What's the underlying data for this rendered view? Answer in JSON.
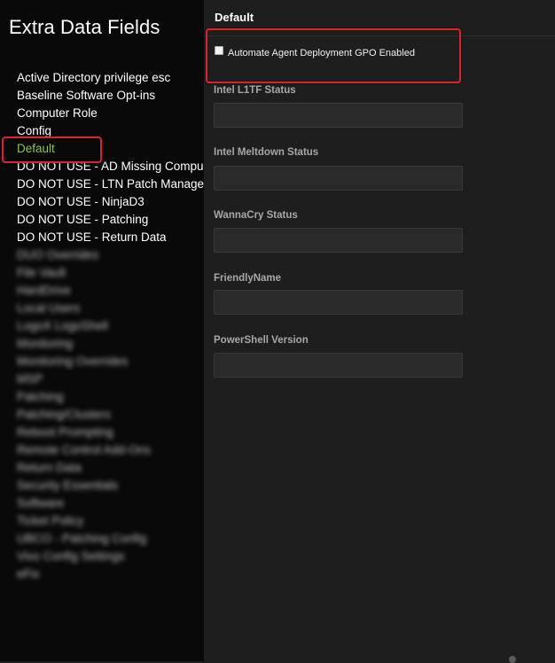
{
  "sidebar": {
    "title": "Extra Data Fields",
    "items": [
      {
        "label": "Active Directory privilege esc",
        "blurred": false
      },
      {
        "label": "Baseline Software Opt-ins",
        "blurred": false
      },
      {
        "label": "Computer Role",
        "blurred": false
      },
      {
        "label": "Config",
        "blurred": false
      },
      {
        "label": "Default",
        "blurred": false,
        "active": true
      },
      {
        "label": "DO NOT USE - AD Missing Compu",
        "blurred": false
      },
      {
        "label": "DO NOT USE - LTN Patch Manage",
        "blurred": false
      },
      {
        "label": "DO NOT USE - NinjaD3",
        "blurred": false
      },
      {
        "label": "DO NOT USE - Patching",
        "blurred": false
      },
      {
        "label": "DO NOT USE - Return Data",
        "blurred": false
      },
      {
        "label": "DUO Overrides",
        "blurred": true
      },
      {
        "label": "File Vault",
        "blurred": true
      },
      {
        "label": "HardDrive",
        "blurred": true
      },
      {
        "label": "Local Users",
        "blurred": true
      },
      {
        "label": "LogoX LogoShell",
        "blurred": true
      },
      {
        "label": "Monitoring",
        "blurred": true
      },
      {
        "label": "Monitoring Overrides",
        "blurred": true
      },
      {
        "label": "MSP",
        "blurred": true
      },
      {
        "label": "Patching",
        "blurred": true
      },
      {
        "label": "Patching/Clusters",
        "blurred": true
      },
      {
        "label": "Reboot Prompting",
        "blurred": true
      },
      {
        "label": "Remote Control Add-Ons",
        "blurred": true
      },
      {
        "label": "Return Data",
        "blurred": true
      },
      {
        "label": "Security Essentials",
        "blurred": true
      },
      {
        "label": "Software",
        "blurred": true
      },
      {
        "label": "Ticket Policy",
        "blurred": true
      },
      {
        "label": "UBCO - Patching Config",
        "blurred": true
      },
      {
        "label": "Vivo Config Settings",
        "blurred": true
      },
      {
        "label": "eFix",
        "blurred": true
      }
    ]
  },
  "panel": {
    "title": "Default",
    "gpo_checkbox": {
      "label": "Automate Agent Deployment GPO Enabled",
      "checked": false
    },
    "fields": [
      {
        "label": "Intel L1TF Status",
        "value": ""
      },
      {
        "label": "Intel Meltdown Status",
        "value": ""
      },
      {
        "label": "WannaCry Status",
        "value": ""
      },
      {
        "label": "FriendlyName",
        "value": ""
      },
      {
        "label": "PowerShell Version",
        "value": ""
      }
    ]
  },
  "colors": {
    "sidebar_bg": "#090909",
    "panel_bg": "#1e1e1e",
    "active_item": "#8bc34a",
    "highlight_box": "#d9232f",
    "input_bg": "#2a2a2a",
    "label_gray": "#a7a7a7"
  }
}
